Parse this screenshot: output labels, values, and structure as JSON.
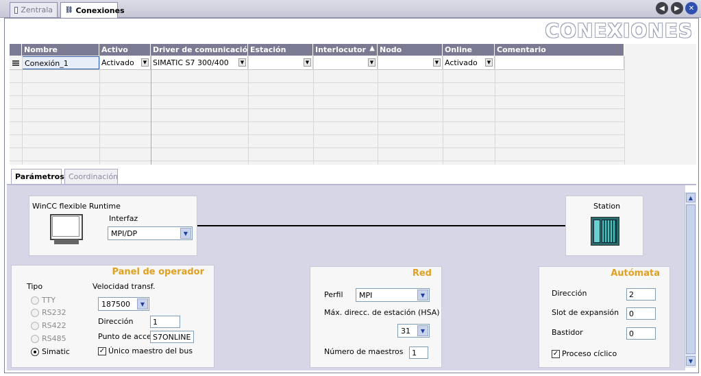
{
  "tabs": [
    {
      "label": "Zentrala",
      "icon": "window-icon",
      "active": false
    },
    {
      "label": "Conexiones",
      "icon": "connections-icon",
      "active": true
    }
  ],
  "page_title": "CONEXIONES",
  "grid": {
    "columns": [
      "Nombre",
      "Activo",
      "Driver de comunicación",
      "Estación",
      "Interlocutor",
      "Nodo",
      "Online",
      "Comentario"
    ],
    "rows": [
      {
        "nombre": "Conexión_1",
        "activo": "Activado",
        "driver": "SIMATIC S7 300/400",
        "estacion": "",
        "interlocutor": "",
        "nodo": "",
        "online": "Activado",
        "comentario": ""
      }
    ]
  },
  "lower_tabs": [
    {
      "label": "Parámetros",
      "active": true
    },
    {
      "label": "Coordinación",
      "active": false
    }
  ],
  "hmi": {
    "title": "WinCC flexible Runtime",
    "interface_label": "Interfaz",
    "interface_value": "MPI/DP"
  },
  "station": {
    "title": "Station"
  },
  "panel": {
    "title": "Panel de operador",
    "tipo_label": "Tipo",
    "tipos": [
      {
        "label": "TTY",
        "selected": false
      },
      {
        "label": "RS232",
        "selected": false
      },
      {
        "label": "RS422",
        "selected": false
      },
      {
        "label": "RS485",
        "selected": false
      },
      {
        "label": "Simatic",
        "selected": true
      }
    ],
    "velocidad_label": "Velocidad transf.",
    "velocidad_value": "187500",
    "direccion_label": "Dirección",
    "direccion_value": "1",
    "punto_label": "Punto de acces",
    "punto_value": "S7ONLINE",
    "unico_label": "Único maestro del bus",
    "unico_checked": true
  },
  "red": {
    "title": "Red",
    "perfil_label": "Perfil",
    "perfil_value": "MPI",
    "hsa_label": "Máx. direcc. de estación (HSA)",
    "hsa_value": "31",
    "maestros_label": "Número de maestros",
    "maestros_value": "1"
  },
  "automata": {
    "title": "Autómata",
    "direccion_label": "Dirección",
    "direccion_value": "2",
    "slot_label": "Slot de expansión",
    "slot_value": "0",
    "bastidor_label": "Bastidor",
    "bastidor_value": "0",
    "ciclico_label": "Proceso cíclico",
    "ciclico_checked": true
  }
}
